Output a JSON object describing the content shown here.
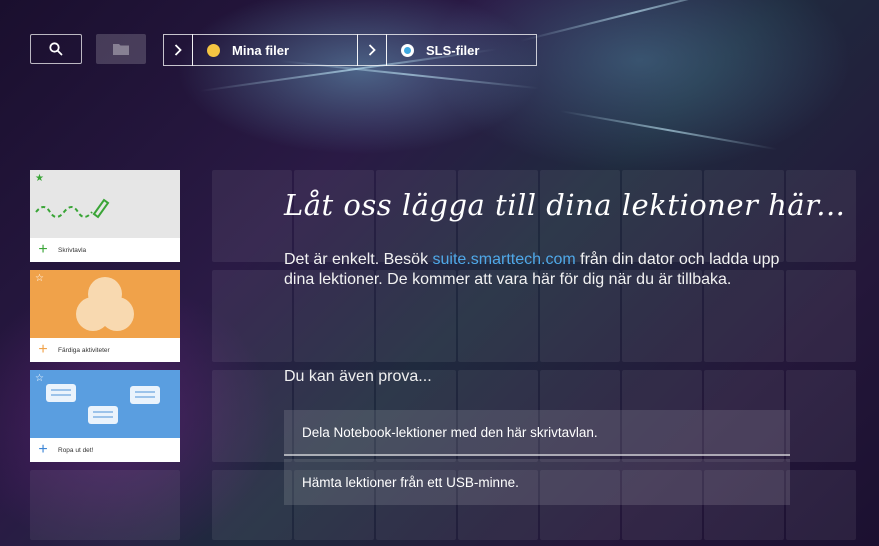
{
  "toolbar": {
    "search_icon": "search-icon",
    "folder_icon": "folder-icon"
  },
  "breadcrumb": {
    "items": [
      {
        "label": "Mina filer",
        "icon": "yellow-circle-icon",
        "icon_color": "#f5c542"
      },
      {
        "label": "SLS-filer",
        "icon": "target-icon",
        "icon_color": "#3fa9e0"
      }
    ]
  },
  "activities": [
    {
      "label": "Skrivtavla",
      "thumb_color": "#e6e6e6",
      "accent": "#3aa537",
      "star_color": "#3aa537"
    },
    {
      "label": "Färdiga aktiviteter",
      "thumb_color": "#f0a24a",
      "accent": "#f0a24a",
      "star_color": "#ffffff"
    },
    {
      "label": "Ropa ut det!",
      "thumb_color": "#5a9ee0",
      "accent": "#3d86d6",
      "star_color": "#ffffff"
    }
  ],
  "main": {
    "title": "Låt oss lägga till dina lektioner här...",
    "para_before": "Det är enkelt. Besök ",
    "link": "suite.smarttech.com",
    "para_after": " från din dator och ladda upp dina lektioner. De kommer att vara här för dig när du är tillbaka.",
    "subhead": "Du kan även prova...",
    "options": [
      "Dela Notebook-lektioner med den här skrivtavlan.",
      "Hämta lektioner från ett USB-minne."
    ]
  },
  "colors": {
    "link": "#4fa8e8"
  }
}
